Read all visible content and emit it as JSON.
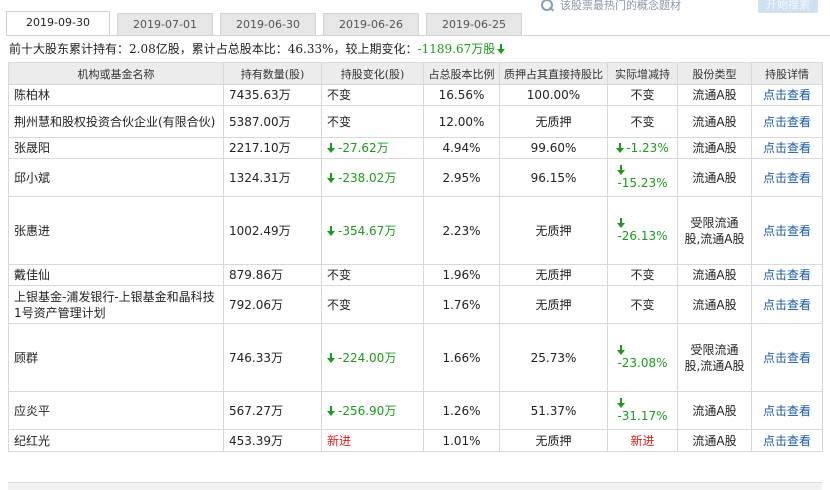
{
  "search": {
    "hint": "该股票最热门的概念题材",
    "button": "开始搜索"
  },
  "tabs": [
    {
      "label": "2019-09-30",
      "active": true
    },
    {
      "label": "2019-07-01",
      "active": false
    },
    {
      "label": "2019-06-30",
      "active": false
    },
    {
      "label": "2019-06-26",
      "active": false
    },
    {
      "label": "2019-06-25",
      "active": false
    }
  ],
  "summary": {
    "prefix": "前十大股东累计持有：",
    "total_shares": "2.08亿股",
    "mid1": "，累计占总股本比：",
    "total_pct": "46.33%",
    "mid2": "，较上期变化：",
    "change": "-1189.67万股"
  },
  "table": {
    "headers": [
      "机构或基金名称",
      "持有数量(股)",
      "持股变化(股)",
      "占总股本比例",
      "质押占其直接持股比",
      "实际增减持",
      "股份类型",
      "持股详情"
    ],
    "rows": [
      {
        "name": "陈柏林",
        "shares": "7435.63万",
        "change": "不变",
        "change_dir": "same",
        "pct": "16.56%",
        "pledge": "100.00%",
        "actual": "不变",
        "actual_dir": "same",
        "type": "流通A股",
        "detail": "点击查看"
      },
      {
        "name": "荆州慧和股权投资合伙企业(有限合伙)",
        "shares": "5387.00万",
        "change": "不变",
        "change_dir": "same",
        "pct": "12.00%",
        "pledge": "无质押",
        "actual": "不变",
        "actual_dir": "same",
        "type": "流通A股",
        "detail": "点击查看"
      },
      {
        "name": "张晟阳",
        "shares": "2217.10万",
        "change": "-27.62万",
        "change_dir": "down",
        "pct": "4.94%",
        "pledge": "99.60%",
        "actual": "-1.23%",
        "actual_dir": "down",
        "type": "流通A股",
        "detail": "点击查看"
      },
      {
        "name": "邱小斌",
        "shares": "1324.31万",
        "change": "-238.02万",
        "change_dir": "down",
        "pct": "2.95%",
        "pledge": "96.15%",
        "actual": "-15.23%",
        "actual_dir": "down-stack",
        "type": "流通A股",
        "detail": "点击查看"
      },
      {
        "name": "张惠进",
        "shares": "1002.49万",
        "change": "-354.67万",
        "change_dir": "down",
        "pct": "2.23%",
        "pledge": "无质押",
        "actual": "-26.13%",
        "actual_dir": "down-stack",
        "type": "受限流通股,流通A股",
        "detail": "点击查看"
      },
      {
        "name": "戴佳仙",
        "shares": "879.86万",
        "change": "不变",
        "change_dir": "same",
        "pct": "1.96%",
        "pledge": "无质押",
        "actual": "不变",
        "actual_dir": "same",
        "type": "流通A股",
        "detail": "点击查看"
      },
      {
        "name": "上银基金-浦发银行-上银基金和晶科技1号资产管理计划",
        "shares": "792.06万",
        "change": "不变",
        "change_dir": "same",
        "pct": "1.76%",
        "pledge": "无质押",
        "actual": "不变",
        "actual_dir": "same",
        "type": "流通A股",
        "detail": "点击查看"
      },
      {
        "name": "顾群",
        "shares": "746.33万",
        "change": "-224.00万",
        "change_dir": "down",
        "pct": "1.66%",
        "pledge": "25.73%",
        "actual": "-23.08%",
        "actual_dir": "down-stack",
        "type": "受限流通股,流通A股",
        "detail": "点击查看"
      },
      {
        "name": "应炎平",
        "shares": "567.27万",
        "change": "-256.90万",
        "change_dir": "down",
        "pct": "1.26%",
        "pledge": "51.37%",
        "actual": "-31.17%",
        "actual_dir": "down-stack",
        "type": "流通A股",
        "detail": "点击查看"
      },
      {
        "name": "纪红光",
        "shares": "453.39万",
        "change": "新进",
        "change_dir": "new",
        "pct": "1.01%",
        "pledge": "无质押",
        "actual": "新进",
        "actual_dir": "new",
        "type": "流通A股",
        "detail": "点击查看"
      }
    ]
  },
  "colors": {
    "increase": "#e02020",
    "decrease": "#1b9a1b",
    "link": "#1a5aa8",
    "header_bg": "#ececec"
  }
}
